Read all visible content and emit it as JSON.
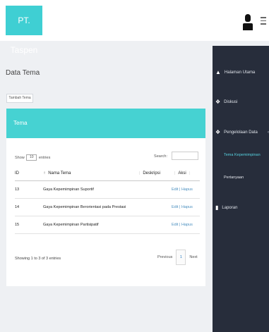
{
  "brand": "PT. Taspen",
  "sidebar": {
    "items": [
      {
        "label": "Halaman Utama",
        "icon": "home-icon"
      },
      {
        "label": "Diskusi",
        "icon": "comments-icon"
      },
      {
        "label": "Pengelolaan Data",
        "icon": "gears-icon"
      },
      {
        "label": "Laporan",
        "icon": "file-icon"
      }
    ],
    "sub_items": [
      "Tema Kepemimpinan",
      "Pertanyaan"
    ]
  },
  "page": {
    "title": "Data Tema",
    "add_button": "Tambah Tema"
  },
  "panel": {
    "title": "Tema",
    "show_label": "Show",
    "show_value": "10",
    "entries_label": "entries",
    "search_label": "Search:",
    "search_value": ""
  },
  "table": {
    "headers": [
      "ID",
      "Nama Tema",
      "Deskripsi",
      "Aksi"
    ],
    "rows": [
      {
        "id": "13",
        "nama": "Gaya Kepemimpinan Suportif",
        "deskripsi": "",
        "aksi": "Edit | Hapus"
      },
      {
        "id": "14",
        "nama": "Gaya Kepemimpinan Berorientasi pada Prestasi",
        "deskripsi": "",
        "aksi": "Edit | Hapus"
      },
      {
        "id": "15",
        "nama": "Gaya Kepemimpinan Partisipatif",
        "deskripsi": "",
        "aksi": "Edit | Hapus"
      }
    ]
  },
  "footer": {
    "info": "Showing 1 to 3 of 3 entries",
    "previous": "Previous",
    "page": "1",
    "next": "Next"
  },
  "colors": {
    "brand": "#3fcfd3",
    "panel_header": "#46d2d2",
    "sidebar": "#272d3b",
    "link": "#4a8fbf"
  }
}
